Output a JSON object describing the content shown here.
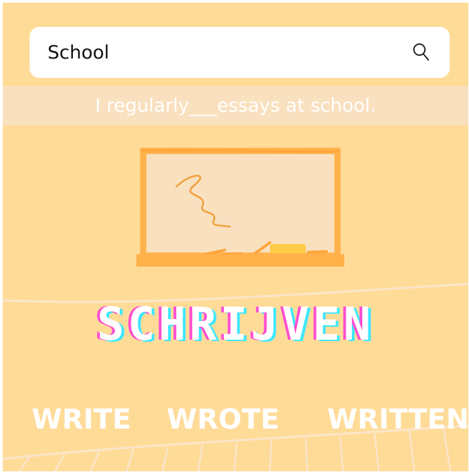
{
  "search": {
    "value": "School",
    "icon": "search-icon"
  },
  "prompt": {
    "sentence": "I regularly___essays at school."
  },
  "word": {
    "title": "SCHRIJVEN"
  },
  "verb_forms": [
    "WRITE",
    "WROTE",
    "WRITTEN"
  ],
  "colors": {
    "background": "#ffdb98",
    "band": "#f9e0bf",
    "board_frame": "#ffb14a",
    "board_surface": "#f9e0bf",
    "title_shadow_pink": "#ff4fd1",
    "title_shadow_cyan": "#3ee7ff"
  },
  "illustration": "chalkboard-icon"
}
